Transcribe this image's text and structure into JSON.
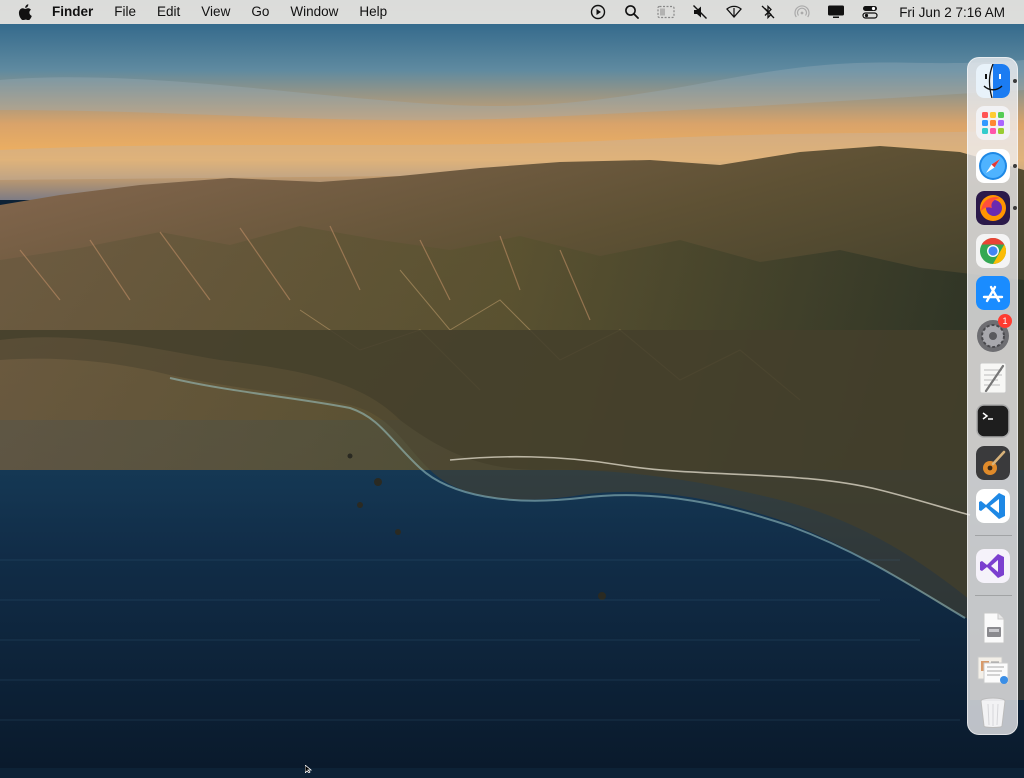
{
  "menubar": {
    "app_name": "Finder",
    "menus": [
      "File",
      "Edit",
      "View",
      "Go",
      "Window",
      "Help"
    ],
    "status_icons": [
      "play-circle-icon",
      "search-icon",
      "display-mirror-icon",
      "mute-icon",
      "wifi-icon",
      "bluetooth-off-icon",
      "airdrop-icon",
      "display-icon",
      "control-center-icon"
    ],
    "clock": "Fri Jun 2  7:16 AM"
  },
  "dock": {
    "apps": [
      {
        "name": "Finder",
        "icon": "finder-icon",
        "running": true
      },
      {
        "name": "Launchpad",
        "icon": "launchpad-icon",
        "running": false
      },
      {
        "name": "Safari",
        "icon": "safari-icon",
        "running": true
      },
      {
        "name": "Firefox",
        "icon": "firefox-icon",
        "running": true
      },
      {
        "name": "Google Chrome",
        "icon": "chrome-icon",
        "running": false
      },
      {
        "name": "App Store",
        "icon": "app-store-icon",
        "running": false
      },
      {
        "name": "System Preferences",
        "icon": "system-preferences-icon",
        "running": false,
        "badge": "1"
      },
      {
        "name": "Script Editor",
        "icon": "script-editor-icon",
        "running": false
      },
      {
        "name": "Terminal",
        "icon": "terminal-icon",
        "running": false
      },
      {
        "name": "GarageBand",
        "icon": "garageband-icon",
        "running": false
      },
      {
        "name": "Visual Studio Code",
        "icon": "vscode-icon",
        "running": false
      }
    ],
    "recent": [
      {
        "name": "Visual Studio",
        "icon": "visual-studio-icon"
      }
    ],
    "stacks": [
      {
        "name": "Document",
        "icon": "document-stack-icon"
      },
      {
        "name": "Downloads",
        "icon": "downloads-stack-icon"
      },
      {
        "name": "Trash",
        "icon": "trash-icon"
      }
    ]
  },
  "colors": {
    "menubar_bg": "#ece7e2",
    "dock_bg": "#f0f0f2",
    "badge": "#ff3b30",
    "running_dot": "#3a3a3a"
  }
}
